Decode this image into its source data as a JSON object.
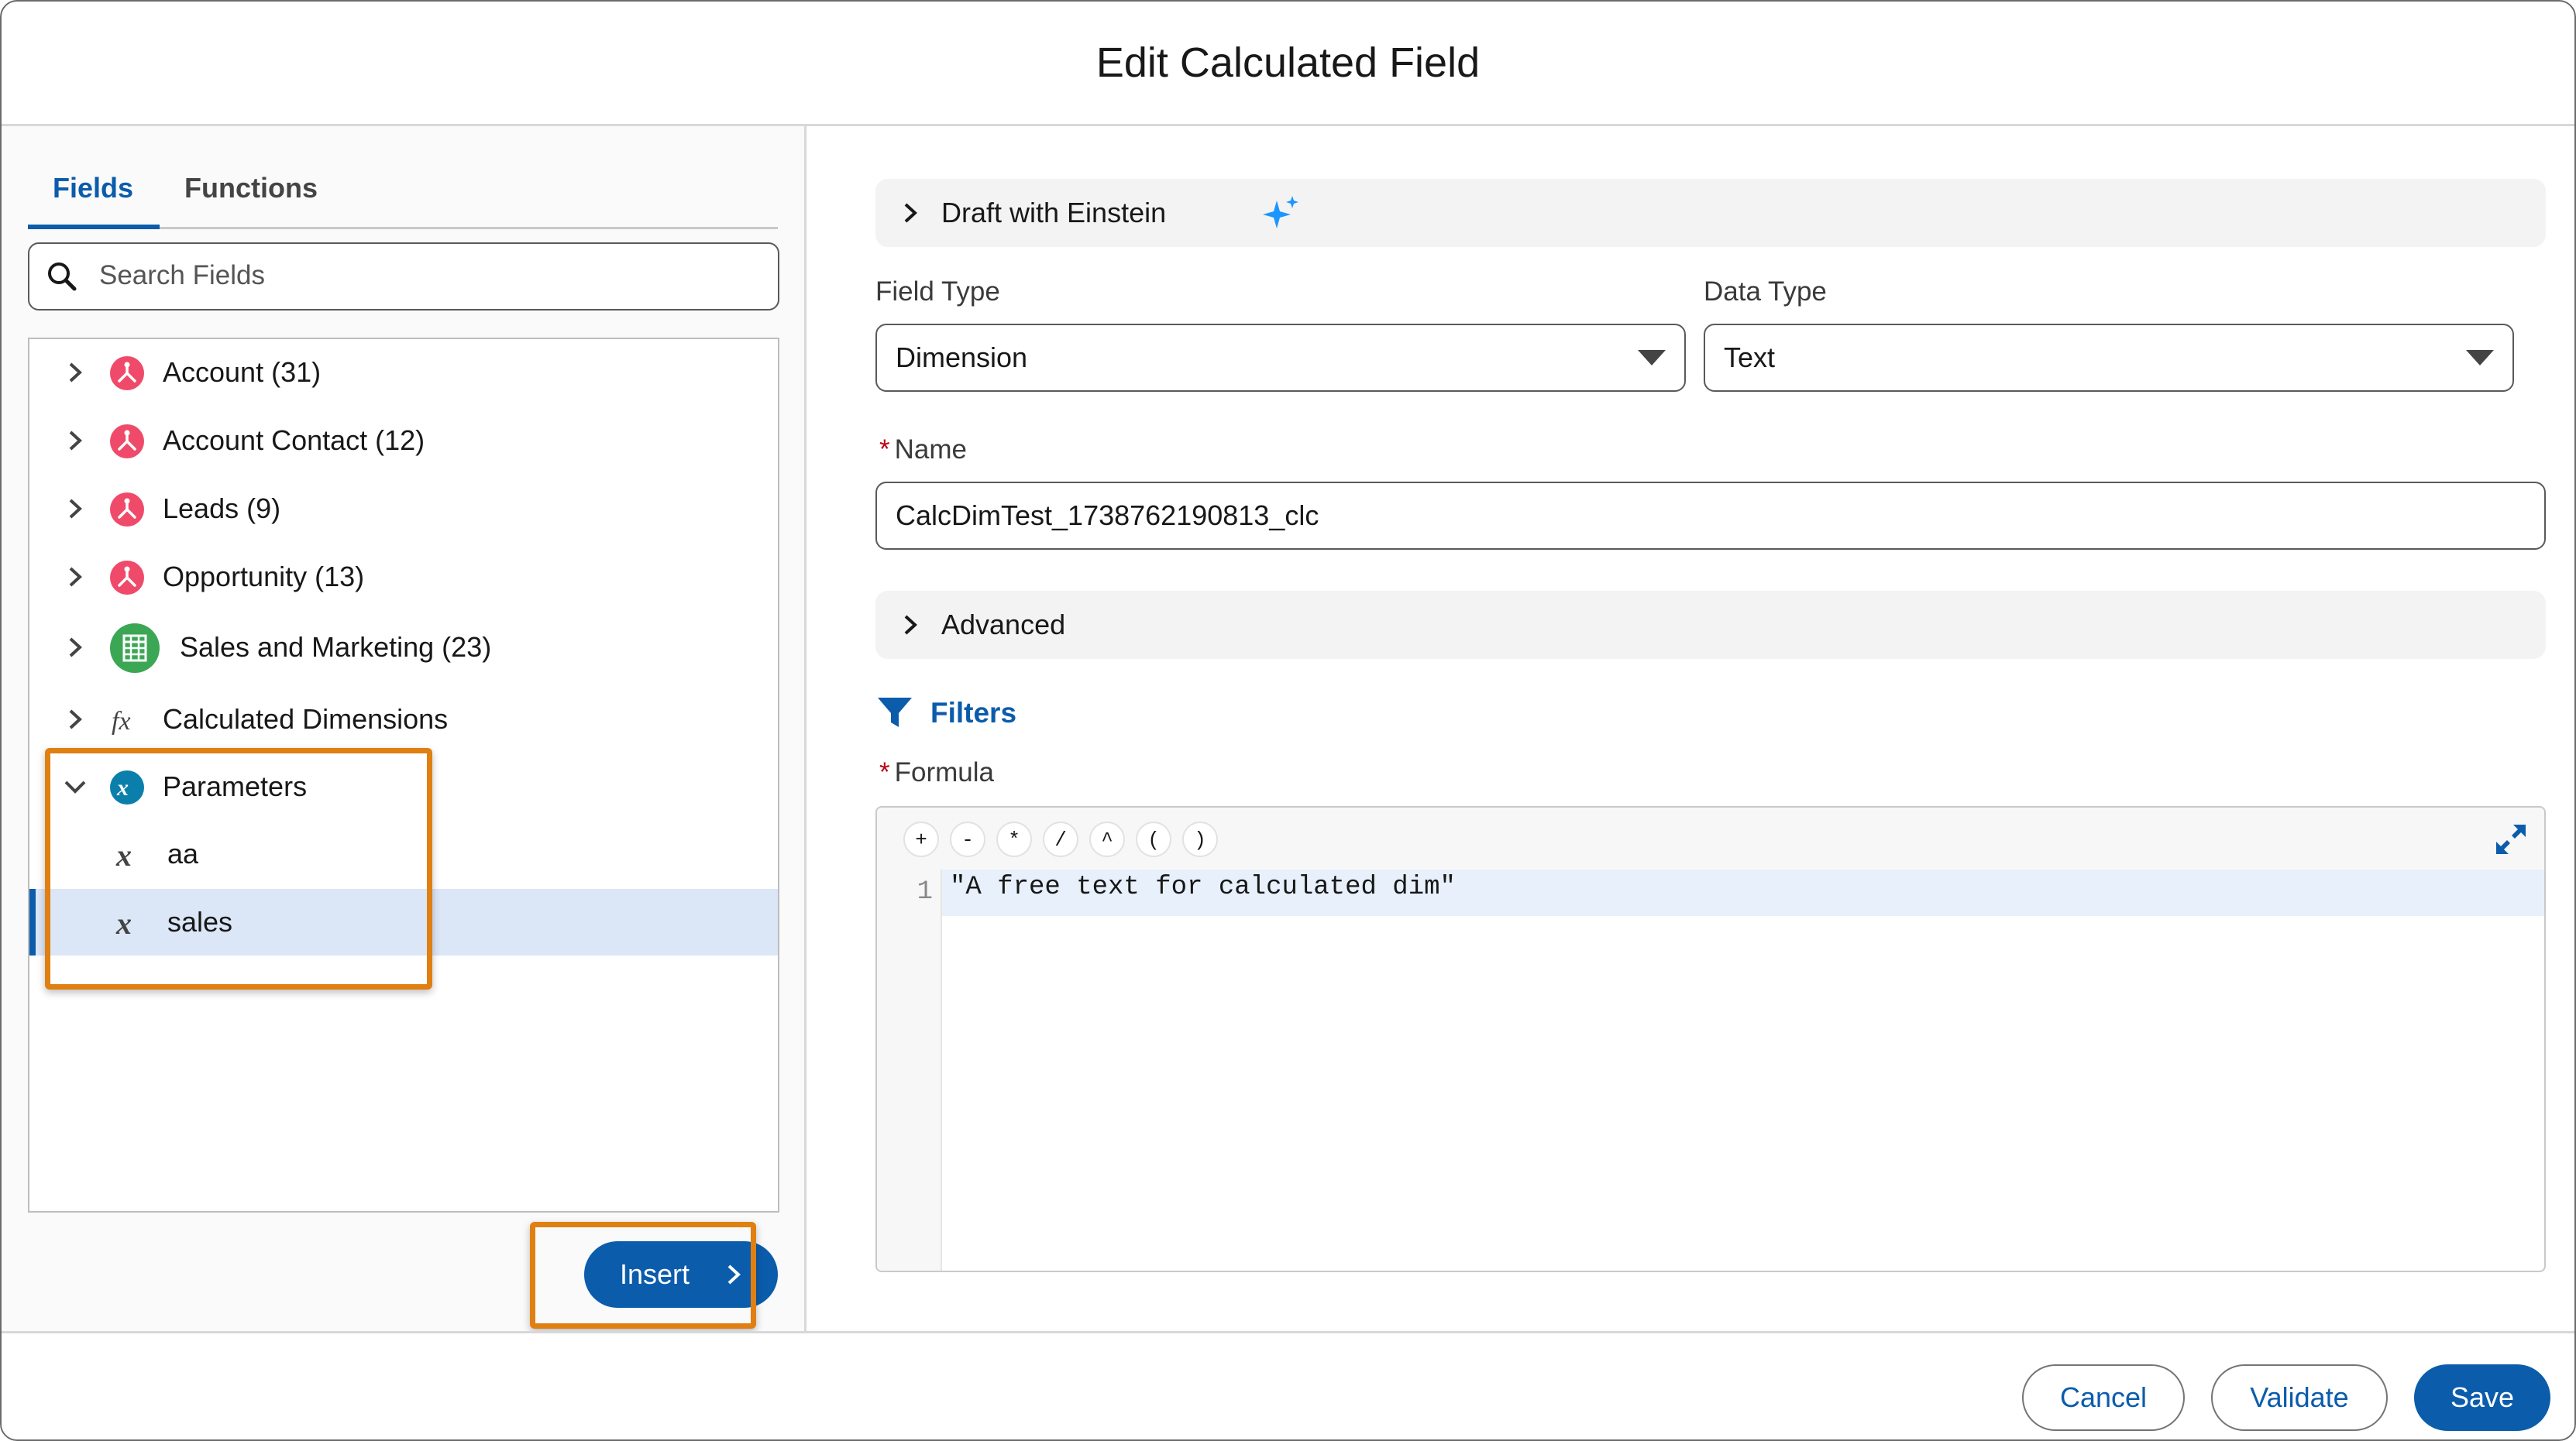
{
  "dialog": {
    "title": "Edit Calculated Field"
  },
  "tabs": [
    {
      "label": "Fields",
      "active": true
    },
    {
      "label": "Functions",
      "active": false
    }
  ],
  "search": {
    "placeholder": "Search Fields",
    "value": ""
  },
  "tree": {
    "items": [
      {
        "label": "Account (31)",
        "icon": "dataset-icon",
        "expanded": false
      },
      {
        "label": "Account Contact (12)",
        "icon": "dataset-icon",
        "expanded": false
      },
      {
        "label": "Leads (9)",
        "icon": "dataset-icon",
        "expanded": false
      },
      {
        "label": "Opportunity (13)",
        "icon": "dataset-icon",
        "expanded": false
      },
      {
        "label": "Sales and Marketing (23)",
        "icon": "table-icon",
        "expanded": false
      },
      {
        "label": "Calculated Dimensions",
        "icon": "function-icon",
        "expanded": false
      },
      {
        "label": "Parameters",
        "icon": "parameter-icon",
        "expanded": true,
        "children": [
          {
            "label": "aa",
            "icon": "variable-icon",
            "selected": false
          },
          {
            "label": "sales",
            "icon": "variable-icon",
            "selected": true
          }
        ]
      }
    ]
  },
  "insert": {
    "label": "Insert"
  },
  "einstein": {
    "label": "Draft with Einstein"
  },
  "form": {
    "field_type": {
      "label": "Field Type",
      "value": "Dimension"
    },
    "data_type": {
      "label": "Data Type",
      "value": "Text"
    },
    "name": {
      "required_mark": "*",
      "label": "Name",
      "value": "CalcDimTest_1738762190813_clc"
    },
    "advanced": {
      "label": "Advanced"
    },
    "filters": {
      "label": "Filters"
    },
    "formula": {
      "required_mark": "*",
      "label": "Formula",
      "operators": [
        "+",
        "-",
        "*",
        "/",
        "^",
        "(",
        ")"
      ],
      "line_number": "1",
      "code": "\"A free text for calculated dim\""
    }
  },
  "footer": {
    "cancel": "Cancel",
    "validate": "Validate",
    "save": "Save"
  },
  "colors": {
    "brand": "#0b5cab",
    "dataset_icon": "#f04a6a",
    "table_icon": "#3ba755",
    "parameter_icon": "#0b7fab",
    "highlight": "#e07f12"
  }
}
